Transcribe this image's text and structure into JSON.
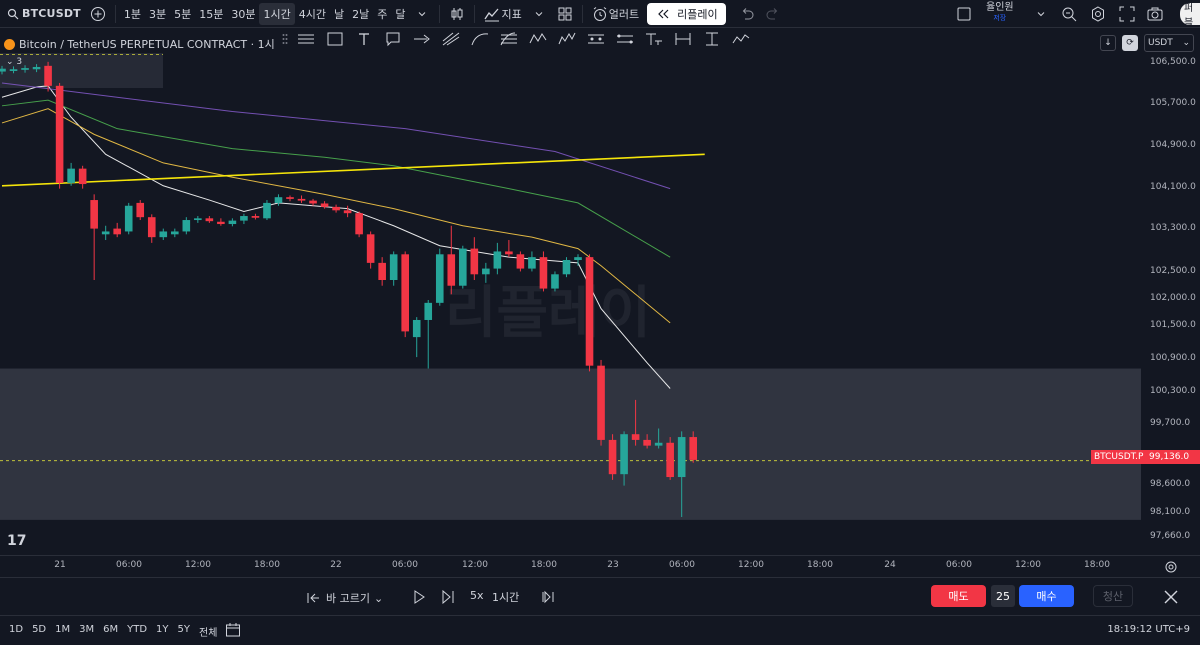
{
  "toolbar": {
    "symbol": "BTCUSDT",
    "intervals": [
      "1분",
      "3분",
      "5분",
      "15분",
      "30분",
      "1시간",
      "4시간",
      "날",
      "2날",
      "주",
      "달"
    ],
    "active_interval": "1시간",
    "indicators_label": "지표",
    "alert_label": "얼러트",
    "replay_label": "리플레이",
    "user_name": "율인원",
    "user_sub": "저장",
    "right_pill": "퍼블"
  },
  "legend": {
    "title": "Bitcoin / TetherUS PERPETUAL CONTRACT · 1시",
    "count": "3"
  },
  "price_axis": {
    "currency": "USDT",
    "ticks": [
      "106,500.0",
      "105,700.0",
      "104,900.0",
      "104,100.0",
      "103,300.0",
      "102,500.0",
      "102,000.0",
      "101,500.0",
      "100,900.0",
      "100,300.0",
      "99,700.0",
      "99,136.0",
      "98,600.0",
      "98,100.0",
      "97,660.0"
    ],
    "current_symbol": "BTCUSDT.P",
    "current_price": "99,136.0"
  },
  "time_axis": {
    "ticks": [
      "21",
      "06:00",
      "12:00",
      "18:00",
      "22",
      "06:00",
      "12:00",
      "18:00",
      "23",
      "06:00",
      "12:00",
      "18:00",
      "24",
      "06:00",
      "12:00",
      "18:00"
    ]
  },
  "watermark": "리플레이",
  "replay_bar": {
    "select_bar_label": "바 고르기",
    "speed": "5x",
    "interval": "1시간",
    "sell_label": "매도",
    "quantity": "25",
    "buy_label": "매수",
    "flatten_label": "청산"
  },
  "bottom_bar": {
    "ranges": [
      "1D",
      "5D",
      "1M",
      "3M",
      "6M",
      "YTD",
      "1Y",
      "5Y",
      "전체"
    ],
    "clock": "18:19:12 UTC+9"
  },
  "colors": {
    "up": "#26a69a",
    "down": "#f23645",
    "background": "#131722"
  },
  "chart_data": {
    "type": "candlestick",
    "interval": "1h",
    "candles": [
      {
        "o": 105950,
        "h": 106050,
        "l": 105900,
        "c": 106000
      },
      {
        "o": 105960,
        "h": 106040,
        "l": 105920,
        "c": 105990
      },
      {
        "o": 105980,
        "h": 106060,
        "l": 105930,
        "c": 106010
      },
      {
        "o": 105990,
        "h": 106080,
        "l": 105940,
        "c": 106030
      },
      {
        "o": 106050,
        "h": 106120,
        "l": 105600,
        "c": 105700
      },
      {
        "o": 105700,
        "h": 105750,
        "l": 103900,
        "c": 104000
      },
      {
        "o": 104000,
        "h": 104350,
        "l": 103950,
        "c": 104250
      },
      {
        "o": 104250,
        "h": 104300,
        "l": 103900,
        "c": 103980
      },
      {
        "o": 103700,
        "h": 103800,
        "l": 102300,
        "c": 103200
      },
      {
        "o": 103100,
        "h": 103250,
        "l": 103000,
        "c": 103150
      },
      {
        "o": 103200,
        "h": 103300,
        "l": 103050,
        "c": 103100
      },
      {
        "o": 103150,
        "h": 103650,
        "l": 103100,
        "c": 103600
      },
      {
        "o": 103650,
        "h": 103700,
        "l": 103350,
        "c": 103400
      },
      {
        "o": 103400,
        "h": 103450,
        "l": 102950,
        "c": 103050
      },
      {
        "o": 103050,
        "h": 103200,
        "l": 103000,
        "c": 103150
      },
      {
        "o": 103100,
        "h": 103200,
        "l": 103050,
        "c": 103150
      },
      {
        "o": 103150,
        "h": 103400,
        "l": 103100,
        "c": 103350
      },
      {
        "o": 103350,
        "h": 103420,
        "l": 103300,
        "c": 103380
      },
      {
        "o": 103380,
        "h": 103420,
        "l": 103300,
        "c": 103330
      },
      {
        "o": 103320,
        "h": 103380,
        "l": 103250,
        "c": 103280
      },
      {
        "o": 103280,
        "h": 103380,
        "l": 103240,
        "c": 103340
      },
      {
        "o": 103340,
        "h": 103460,
        "l": 103280,
        "c": 103420
      },
      {
        "o": 103420,
        "h": 103460,
        "l": 103360,
        "c": 103390
      },
      {
        "o": 103380,
        "h": 103700,
        "l": 103350,
        "c": 103650
      },
      {
        "o": 103650,
        "h": 103800,
        "l": 103600,
        "c": 103750
      },
      {
        "o": 103750,
        "h": 103780,
        "l": 103680,
        "c": 103720
      },
      {
        "o": 103720,
        "h": 103780,
        "l": 103650,
        "c": 103690
      },
      {
        "o": 103690,
        "h": 103720,
        "l": 103600,
        "c": 103640
      },
      {
        "o": 103640,
        "h": 103680,
        "l": 103550,
        "c": 103580
      },
      {
        "o": 103580,
        "h": 103620,
        "l": 103480,
        "c": 103520
      },
      {
        "o": 103520,
        "h": 103600,
        "l": 103400,
        "c": 103470
      },
      {
        "o": 103470,
        "h": 103500,
        "l": 103050,
        "c": 103100
      },
      {
        "o": 103100,
        "h": 103150,
        "l": 102500,
        "c": 102600
      },
      {
        "o": 102600,
        "h": 102700,
        "l": 102200,
        "c": 102300
      },
      {
        "o": 102300,
        "h": 102800,
        "l": 102200,
        "c": 102750
      },
      {
        "o": 102750,
        "h": 102800,
        "l": 101300,
        "c": 101400
      },
      {
        "o": 101300,
        "h": 101650,
        "l": 100950,
        "c": 101600
      },
      {
        "o": 101600,
        "h": 101950,
        "l": 100750,
        "c": 101900
      },
      {
        "o": 101900,
        "h": 102850,
        "l": 101850,
        "c": 102750
      },
      {
        "o": 102750,
        "h": 103250,
        "l": 102050,
        "c": 102200
      },
      {
        "o": 102200,
        "h": 102900,
        "l": 102150,
        "c": 102850
      },
      {
        "o": 102850,
        "h": 103050,
        "l": 102300,
        "c": 102400
      },
      {
        "o": 102400,
        "h": 102600,
        "l": 102250,
        "c": 102500
      },
      {
        "o": 102500,
        "h": 102950,
        "l": 102400,
        "c": 102800
      },
      {
        "o": 102800,
        "h": 103000,
        "l": 102700,
        "c": 102750
      },
      {
        "o": 102750,
        "h": 102800,
        "l": 102450,
        "c": 102500
      },
      {
        "o": 102500,
        "h": 102800,
        "l": 102450,
        "c": 102700
      },
      {
        "o": 102700,
        "h": 102800,
        "l": 102100,
        "c": 102150
      },
      {
        "o": 102150,
        "h": 102450,
        "l": 102100,
        "c": 102400
      },
      {
        "o": 102400,
        "h": 102700,
        "l": 102350,
        "c": 102650
      },
      {
        "o": 102650,
        "h": 102750,
        "l": 102550,
        "c": 102700
      },
      {
        "o": 102700,
        "h": 102750,
        "l": 100700,
        "c": 100800
      },
      {
        "o": 100800,
        "h": 100900,
        "l": 99400,
        "c": 99500
      },
      {
        "o": 99500,
        "h": 99600,
        "l": 98800,
        "c": 98900
      },
      {
        "o": 98900,
        "h": 99650,
        "l": 98700,
        "c": 99600
      },
      {
        "o": 99600,
        "h": 100200,
        "l": 99400,
        "c": 99500
      },
      {
        "o": 99500,
        "h": 99600,
        "l": 99350,
        "c": 99400
      },
      {
        "o": 99400,
        "h": 99700,
        "l": 99350,
        "c": 99450
      },
      {
        "o": 99450,
        "h": 99550,
        "l": 98800,
        "c": 98850
      },
      {
        "o": 98850,
        "h": 99650,
        "l": 98150,
        "c": 99550
      },
      {
        "o": 99550,
        "h": 99650,
        "l": 99100,
        "c": 99150
      }
    ],
    "moving_averages": [
      {
        "color": "#ffffff",
        "values": [
          [
            0,
            105500
          ],
          [
            3,
            105680
          ],
          [
            4,
            105700
          ],
          [
            6,
            105150
          ],
          [
            9,
            104500
          ],
          [
            14,
            103950
          ],
          [
            18,
            103700
          ],
          [
            21,
            103500
          ],
          [
            24,
            103650
          ],
          [
            30,
            103550
          ],
          [
            34,
            103250
          ],
          [
            38,
            102900
          ],
          [
            44,
            102700
          ],
          [
            50,
            102600
          ],
          [
            52,
            101800
          ],
          [
            56,
            100850
          ],
          [
            58,
            100400
          ]
        ]
      },
      {
        "color": "#f7c948",
        "values": [
          [
            0,
            105050
          ],
          [
            4,
            105300
          ],
          [
            8,
            104850
          ],
          [
            14,
            104350
          ],
          [
            20,
            104100
          ],
          [
            28,
            103800
          ],
          [
            34,
            103550
          ],
          [
            40,
            103250
          ],
          [
            46,
            103050
          ],
          [
            50,
            102850
          ],
          [
            52,
            102550
          ],
          [
            58,
            101550
          ]
        ]
      },
      {
        "color": "#4caf50",
        "values": [
          [
            0,
            105350
          ],
          [
            4,
            105450
          ],
          [
            10,
            104950
          ],
          [
            20,
            104600
          ],
          [
            28,
            104450
          ],
          [
            34,
            104300
          ],
          [
            44,
            103900
          ],
          [
            50,
            103650
          ],
          [
            58,
            102700
          ]
        ]
      },
      {
        "color": "#7e57c2",
        "values": [
          [
            0,
            105750
          ],
          [
            6,
            105600
          ],
          [
            20,
            105250
          ],
          [
            35,
            104950
          ],
          [
            48,
            104550
          ],
          [
            58,
            103900
          ]
        ]
      }
    ],
    "trendline": {
      "color": "#f5e50a",
      "from": [
        0,
        103950
      ],
      "to": [
        61,
        104500
      ]
    },
    "dashed_lines": [
      99136,
      106250
    ],
    "zone": {
      "from": 98100,
      "to": 100750
    },
    "ylim": [
      97660,
      106800
    ]
  }
}
